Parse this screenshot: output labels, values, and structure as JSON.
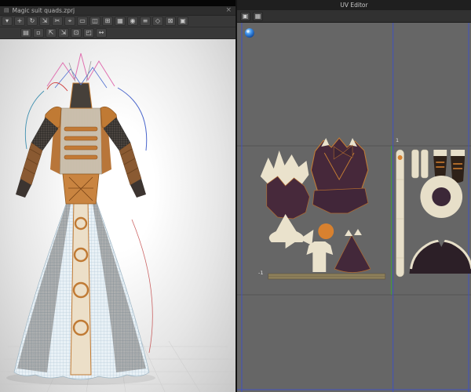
{
  "left_panel": {
    "title": "Magic suit quads.zprj",
    "doc_glyph": "▤",
    "close_glyph": "×",
    "toolbar_row1": [
      {
        "name": "cursor-tool-icon",
        "glyph": "▾"
      },
      {
        "name": "add-point-tool-icon",
        "glyph": "+"
      },
      {
        "name": "rotate-tool-icon",
        "glyph": "↻"
      },
      {
        "name": "scale-tool-icon",
        "glyph": "⇲"
      },
      {
        "name": "scissors-tool-icon",
        "glyph": "✂"
      },
      {
        "name": "target-tool-icon",
        "glyph": "⌖"
      },
      {
        "name": "rectangle-pattern-icon",
        "glyph": "▭"
      },
      {
        "name": "split-panel-icon",
        "glyph": "◫"
      },
      {
        "name": "grid-add-icon",
        "glyph": "⊞"
      },
      {
        "name": "mesh-grid-icon",
        "glyph": "▦"
      },
      {
        "name": "pin-tool-icon",
        "glyph": "◉"
      },
      {
        "name": "menu-lines-icon",
        "glyph": "≡"
      },
      {
        "name": "diamond-tool-icon",
        "glyph": "◇"
      },
      {
        "name": "delete-box-icon",
        "glyph": "⊠"
      },
      {
        "name": "frame-tool-icon",
        "glyph": "▣"
      }
    ],
    "toolbar_row2": [
      {
        "name": "layers-icon",
        "glyph": "▤"
      },
      {
        "name": "dashed-box-icon",
        "glyph": "▫"
      },
      {
        "name": "snap-corner-in-icon",
        "glyph": "⇱"
      },
      {
        "name": "snap-corner-out-icon",
        "glyph": "⇲"
      },
      {
        "name": "dot-box-icon",
        "glyph": "⊡"
      },
      {
        "name": "quarter-box-icon",
        "glyph": "◰"
      },
      {
        "name": "arrows-horizontal-icon",
        "glyph": "↔"
      }
    ]
  },
  "uv_editor": {
    "title": "UV Editor",
    "toolbar": [
      {
        "name": "packed-islands-icon",
        "glyph": "▣"
      },
      {
        "name": "checker-texture-icon",
        "glyph": "▦"
      }
    ],
    "labels": {
      "u_max": "1",
      "u_min": "-1"
    }
  },
  "colors": {
    "topbar": "#060606",
    "titlebar": "#2d2d2d",
    "toolbar": "#383838",
    "uv_background": "#666666",
    "uv_gridline": "#545454",
    "uv_blue_guide": "#4152c0",
    "uv_green_guide": "#3f9f3f",
    "island_cream": "#eae2cc",
    "island_maroon": "#47293b",
    "island_orange": "#d8812f",
    "garment_copper": "#c07a34",
    "garment_skirt_blue": "#dcebf3"
  }
}
